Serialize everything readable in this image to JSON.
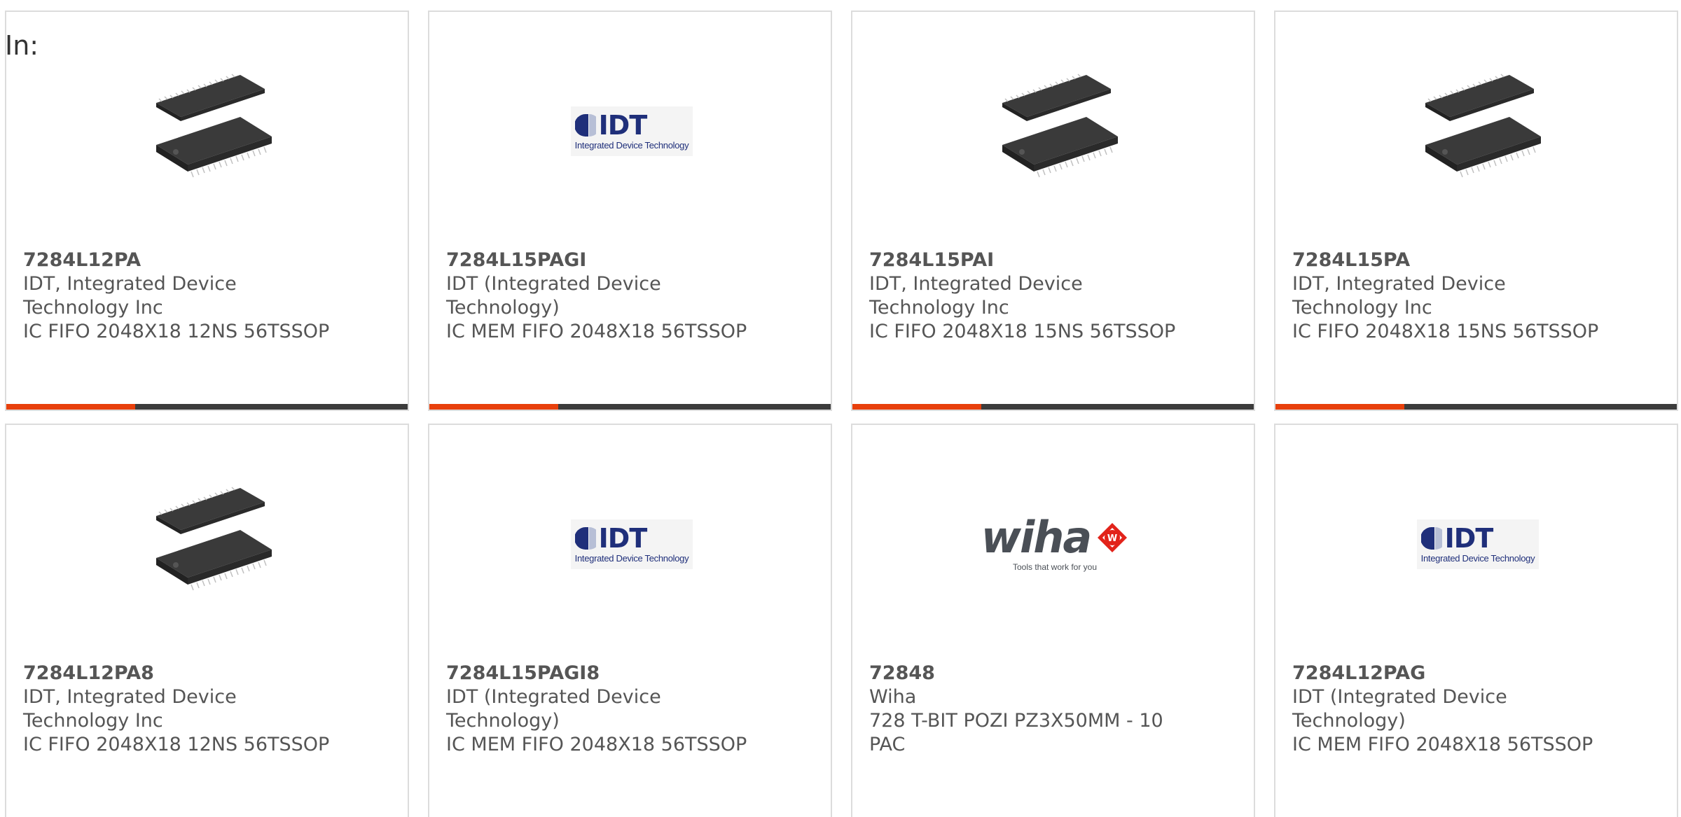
{
  "filter": {
    "label": "In:"
  },
  "products": [
    {
      "part_number": "7284L12PA",
      "manufacturer_line1": "IDT, Integrated Device",
      "manufacturer_line2": "Technology Inc",
      "description": "IC FIFO 2048X18 12NS 56TSSOP",
      "image": "tssop-chip-image"
    },
    {
      "part_number": "7284L15PAGI",
      "manufacturer_line1": "IDT (Integrated Device",
      "manufacturer_line2": "Technology)",
      "description": "IC MEM FIFO 2048X18 56TSSOP",
      "image": "idt-logo",
      "logo": {
        "text": "IDT",
        "tagline": "Integrated Device Technology"
      }
    },
    {
      "part_number": "7284L15PAI",
      "manufacturer_line1": "IDT, Integrated Device",
      "manufacturer_line2": "Technology Inc",
      "description": "IC FIFO 2048X18 15NS 56TSSOP",
      "image": "tssop-chip-image"
    },
    {
      "part_number": "7284L15PA",
      "manufacturer_line1": "IDT, Integrated Device",
      "manufacturer_line2": "Technology Inc",
      "description": "IC FIFO 2048X18 15NS 56TSSOP",
      "image": "tssop-chip-image"
    },
    {
      "part_number": "7284L12PA8",
      "manufacturer_line1": "IDT, Integrated Device",
      "manufacturer_line2": "Technology Inc",
      "description": "IC FIFO 2048X18 12NS 56TSSOP",
      "image": "tssop-chip-image"
    },
    {
      "part_number": "7284L15PAGI8",
      "manufacturer_line1": "IDT (Integrated Device",
      "manufacturer_line2": "Technology)",
      "description": "IC MEM FIFO 2048X18 56TSSOP",
      "image": "idt-logo",
      "logo": {
        "text": "IDT",
        "tagline": "Integrated Device Technology"
      }
    },
    {
      "part_number": "72848",
      "manufacturer_line1": "Wiha",
      "manufacturer_line2": "",
      "description_line1": "728 T-BIT POZI PZ3X50MM - 10",
      "description_line2": "PAC",
      "image": "wiha-logo",
      "logo": {
        "text": "wiha",
        "tagline": "Tools that work for you"
      }
    },
    {
      "part_number": "7284L12PAG",
      "manufacturer_line1": "IDT (Integrated Device",
      "manufacturer_line2": "Technology)",
      "description": "IC MEM FIFO 2048X18 56TSSOP",
      "image": "idt-logo",
      "logo": {
        "text": "IDT",
        "tagline": "Integrated Device Technology"
      }
    }
  ],
  "colors": {
    "accent": "#e8400c",
    "bar": "#3c3c3c",
    "idt_blue": "#1f2f7a",
    "wiha_red": "#e2231a",
    "text": "#555555"
  }
}
